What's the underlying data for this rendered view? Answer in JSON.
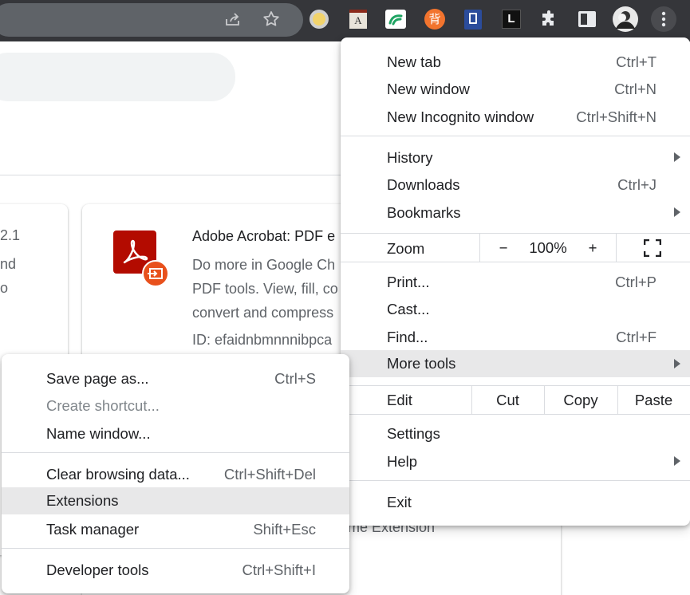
{
  "toolbar": {
    "icons": [
      "share-icon",
      "bookmark-star-icon",
      "extension-yellow-circle-icon",
      "extension-dictionary-icon",
      "extension-green-icon",
      "extension-orange-bei-icon",
      "extension-blue-book-icon",
      "extension-black-l-icon",
      "extensions-puzzle-icon",
      "side-panel-icon",
      "profile-avatar",
      "chrome-menu-kebab-icon"
    ],
    "bei_glyph": "背",
    "dict_glyph": "A",
    "l_glyph": "L"
  },
  "page": {
    "card_left": {
      "version": "2.1",
      "line1": "nd",
      "line2": "o"
    },
    "card_main": {
      "title": "Adobe Acrobat: PDF e",
      "desc1": "Do more in Google Ch",
      "desc2": "PDF tools. View, fill, co",
      "desc3": "convert and compress",
      "id": "ID: efaidnbmnnnibpca"
    },
    "behind_text": "me Extension"
  },
  "main_menu": {
    "new_tab": {
      "label": "New tab",
      "shortcut": "Ctrl+T"
    },
    "new_window": {
      "label": "New window",
      "shortcut": "Ctrl+N"
    },
    "new_incognito": {
      "label": "New Incognito window",
      "shortcut": "Ctrl+Shift+N"
    },
    "history": {
      "label": "History"
    },
    "downloads": {
      "label": "Downloads",
      "shortcut": "Ctrl+J"
    },
    "bookmarks": {
      "label": "Bookmarks"
    },
    "zoom": {
      "label": "Zoom",
      "minus": "−",
      "value": "100%",
      "plus": "+"
    },
    "print": {
      "label": "Print...",
      "shortcut": "Ctrl+P"
    },
    "cast": {
      "label": "Cast..."
    },
    "find": {
      "label": "Find...",
      "shortcut": "Ctrl+F"
    },
    "more_tools": {
      "label": "More tools"
    },
    "edit": {
      "label": "Edit",
      "cut": "Cut",
      "copy": "Copy",
      "paste": "Paste"
    },
    "settings": {
      "label": "Settings"
    },
    "help": {
      "label": "Help"
    },
    "exit": {
      "label": "Exit"
    }
  },
  "sub_menu": {
    "save_page": {
      "label": "Save page as...",
      "shortcut": "Ctrl+S"
    },
    "create_shortcut": {
      "label": "Create shortcut..."
    },
    "name_window": {
      "label": "Name window..."
    },
    "clear_data": {
      "label": "Clear browsing data...",
      "shortcut": "Ctrl+Shift+Del"
    },
    "extensions": {
      "label": "Extensions"
    },
    "task_manager": {
      "label": "Task manager",
      "shortcut": "Shift+Esc"
    },
    "dev_tools": {
      "label": "Developer tools",
      "shortcut": "Ctrl+Shift+I"
    }
  },
  "colors": {
    "toolbar": "#35363a",
    "menu_highlight": "#e8e8e9",
    "acrobat_red": "#b30b00",
    "acrobat_badge": "#e8501c"
  }
}
